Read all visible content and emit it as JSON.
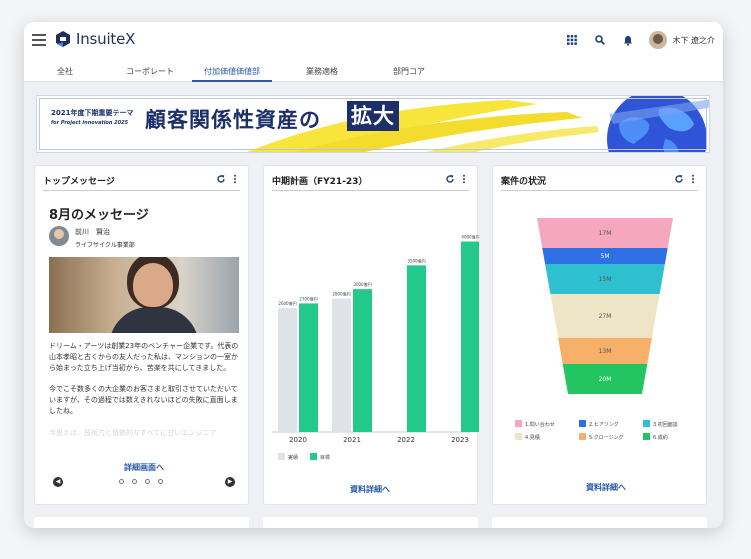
{
  "app": {
    "name": "InsuiteX"
  },
  "user": {
    "name": "木下 遼之介"
  },
  "tabs": [
    "全社",
    "コーポレート",
    "付加価値価値部",
    "業務適格",
    "部門コア"
  ],
  "banner": {
    "line1": "2021年度下期重要テーマ",
    "line2": "for Project innovation 2025",
    "main": "顧客関係性資産の",
    "highlight": "拡大"
  },
  "card1": {
    "title": "トップメッセージ",
    "msg_title": "8月のメッセージ",
    "author": "前川　賢治",
    "dept": "ライフサイクル事業部",
    "paragraph1": "ドリーム・アーツは創業23年のベンチャー企業です。代表の山本孝昭と古くからの友人だった私は、マンションの一室から始まった立ち上げ当初から、苦楽を共にしてきました。",
    "paragraph2": "今でこそ数多くの大企業のお客さまと取引させていただいていますが、その過程では数えきれないほどの失敗に直面しましたね。",
    "faded": "今思えば、技術力と情熱的なすべてに甘いエンジニア",
    "link": "詳細画面へ"
  },
  "card2": {
    "title": "中期計画（FY21-23）",
    "link": "資料詳細へ"
  },
  "card3": {
    "title": "案件の状況",
    "link": "資料詳細へ"
  },
  "chart_data": [
    {
      "type": "bar",
      "categories": [
        "2020",
        "2021",
        "2022",
        "2023"
      ],
      "series": [
        {
          "name": "実績",
          "values": [
            2600,
            2800,
            null,
            null
          ],
          "labels": [
            "2600億円",
            "2800億円",
            "",
            ""
          ],
          "color": "#dfe2e6"
        },
        {
          "name": "目標",
          "values": [
            2700,
            3000,
            3500,
            4000
          ],
          "labels": [
            "2700億円",
            "3000億円",
            "3500億円",
            "4000億円"
          ],
          "color": "#22c98a"
        }
      ],
      "ylim": [
        0,
        4200
      ]
    },
    {
      "type": "bar",
      "subtype": "funnel",
      "categories": [
        "1.問い合わせ",
        "2.ヒアリング",
        "3.初回面談",
        "4.見積",
        "5.クロージング",
        "6.成約"
      ],
      "values": [
        17,
        5,
        15,
        27,
        13,
        20
      ],
      "labels": [
        "17M",
        "5M",
        "15M",
        "27M",
        "13M",
        "20M"
      ],
      "colors": [
        "#f4a7bf",
        "#2f6fe6",
        "#2fc0cf",
        "#eee5c6",
        "#f7b069",
        "#22c561"
      ]
    }
  ]
}
